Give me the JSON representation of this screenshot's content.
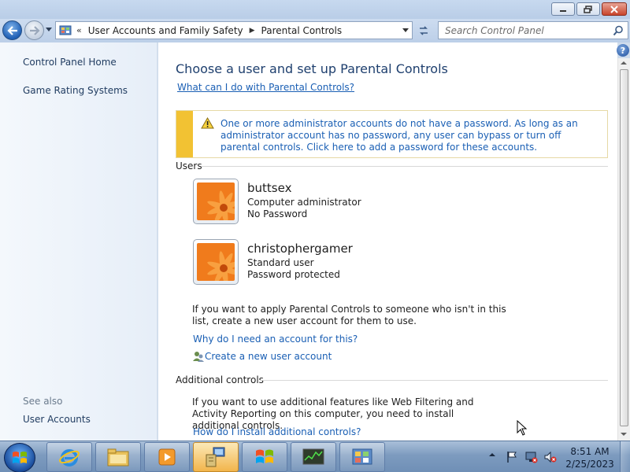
{
  "window": {
    "controls": {
      "minimize": "minimize",
      "maximize": "maximize",
      "close": "close"
    }
  },
  "address_bar": {
    "overflow": "«",
    "crumbs": [
      "User Accounts and Family Safety",
      "Parental Controls"
    ],
    "search_placeholder": "Search Control Panel"
  },
  "left_pane": {
    "links": [
      "Control Panel Home",
      "Game Rating Systems"
    ],
    "see_also_label": "See also",
    "see_also_links": [
      "User Accounts"
    ]
  },
  "main": {
    "title": "Choose a user and set up Parental Controls",
    "what_link": "What can I do with Parental Controls?",
    "warning": "One or more administrator accounts do not have a password. As long as an administrator account has no password, any user can bypass or turn off parental controls. Click here to add a password for these accounts.",
    "users_header": "Users",
    "users": [
      {
        "name": "buttsex",
        "type": "Computer administrator",
        "status": "No Password"
      },
      {
        "name": "christophergamer",
        "type": "Standard user",
        "status": "Password protected"
      }
    ],
    "apply_text": "If you want to apply Parental Controls to someone who isn't in this list, create a new user account for them to use.",
    "why_link": "Why do I need an account for this?",
    "create_link": "Create a new user account",
    "additional_header": "Additional controls",
    "additional_text": "If you want to use additional features like Web Filtering and Activity Reporting on this computer, you need to install additional controls.",
    "install_link": "How do I install additional controls?"
  },
  "taskbar": {
    "pinned": [
      "internet-explorer-icon",
      "windows-explorer-icon",
      "media-player-icon",
      "control-panel-setup-icon",
      "windows-update-icon",
      "task-manager-icon",
      "control-panel-icon"
    ],
    "time": "8:51 AM",
    "date": "2/25/2023"
  },
  "colors": {
    "link": "#1a5fb4",
    "title": "#1e3f6e",
    "warning_bar": "#f2c233"
  }
}
